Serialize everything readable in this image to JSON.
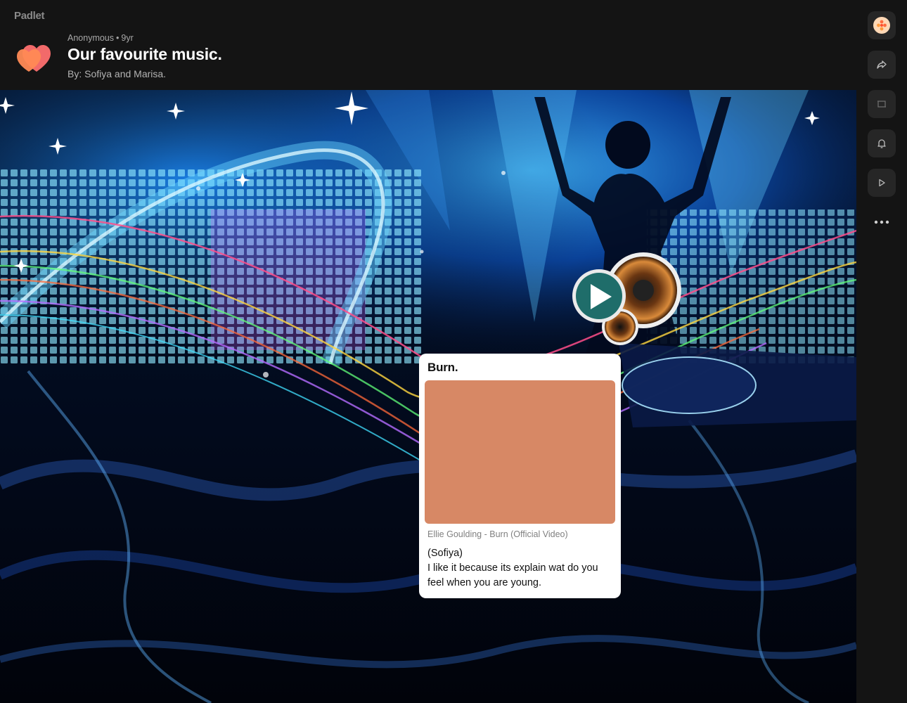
{
  "app": {
    "brand": "Padlet"
  },
  "header": {
    "author": "Anonymous",
    "separator": "•",
    "age": "9yr",
    "title": "Our favourite music.",
    "subtitle": "By: Sofiya and Marisa.",
    "icon": "hearts-icon"
  },
  "rail": {
    "buttons": [
      {
        "name": "avatar-button",
        "icon": "padlet-avatar-icon"
      },
      {
        "name": "share-button",
        "icon": "share-arrow-icon"
      },
      {
        "name": "remake-button",
        "icon": "frame-icon",
        "disabled": true
      },
      {
        "name": "notifications-button",
        "icon": "bell-icon"
      },
      {
        "name": "slideshow-button",
        "icon": "play-icon"
      },
      {
        "name": "more-button",
        "icon": "more-horizontal-icon"
      }
    ]
  },
  "post": {
    "title": "Burn.",
    "media_caption": "Ellie Goulding - Burn (Official Video)",
    "body_line1": "(Sofiya)",
    "body_line2": "I like it because its explain wat do you feel when you are young.",
    "media_color": "#d78865"
  },
  "colors": {
    "background": "#141414",
    "heart_front": "#ff7a52",
    "heart_back": "#f26a6a",
    "card": "#ffffff"
  }
}
